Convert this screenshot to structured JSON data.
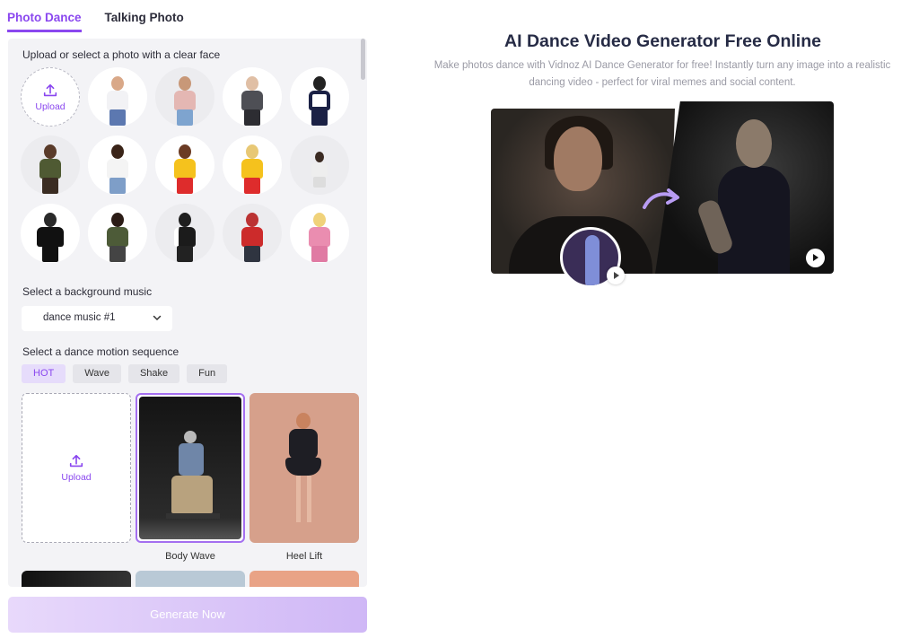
{
  "tabs": [
    {
      "label": "Photo Dance",
      "active": true
    },
    {
      "label": "Talking Photo",
      "active": false
    }
  ],
  "panel": {
    "photo_label": "Upload or select a photo with a clear face",
    "upload_label": "Upload",
    "music_label": "Select a background music",
    "music_selected": "dance music #1",
    "motion_label": "Select a dance motion sequence",
    "chips": [
      "HOT",
      "Wave",
      "Shake",
      "Fun"
    ],
    "active_chip": "HOT",
    "motion_upload_label": "Upload",
    "motions": [
      {
        "label": "Body Wave",
        "selected": true
      },
      {
        "label": "Heel Lift",
        "selected": false
      }
    ],
    "generate_label": "Generate Now"
  },
  "hero": {
    "title": "AI Dance Video Generator Free Online",
    "subtitle": "Make photos dance with Vidnoz AI Dance Generator for free! Instantly turn any image into a realistic dancing video - perfect for viral memes and social content."
  },
  "colors": {
    "accent": "#8a47ef",
    "panel_bg": "#f3f3f6",
    "title": "#262b45"
  }
}
